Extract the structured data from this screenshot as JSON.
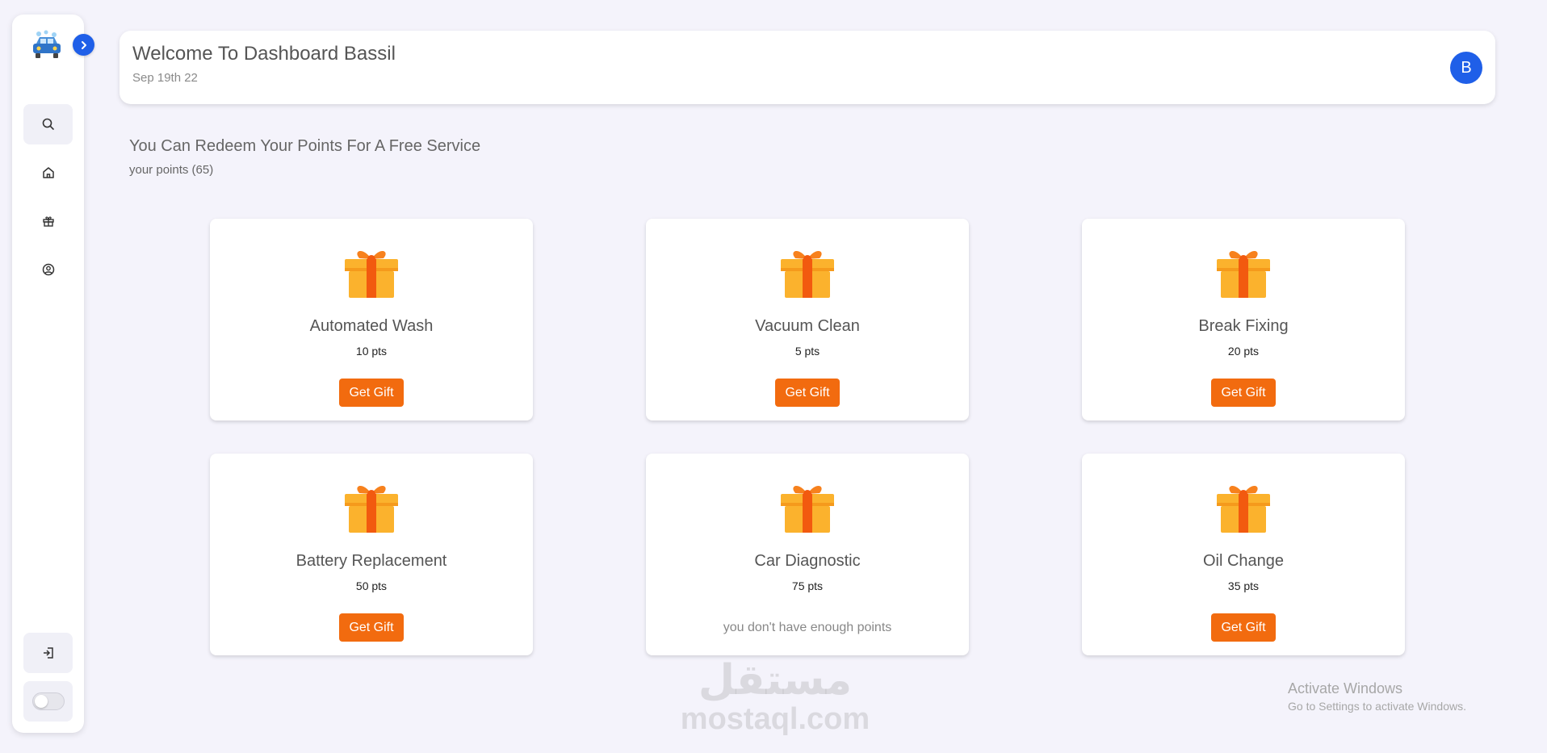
{
  "header": {
    "title": "Welcome To Dashboard Bassil",
    "date": "Sep 19th 22",
    "avatar_letter": "B"
  },
  "sidebar": {
    "items": [
      {
        "icon": "search-icon",
        "active": true
      },
      {
        "icon": "home-icon",
        "active": false
      },
      {
        "icon": "gift-icon",
        "active": false
      },
      {
        "icon": "user-circle-icon",
        "active": false
      }
    ],
    "logout_icon": "logout-icon",
    "expand_icon": "chevron-right-icon"
  },
  "rewards": {
    "title": "You Can Redeem Your Points For A Free Service",
    "points_label": "your points (65)",
    "cards": [
      {
        "name": "Automated Wash",
        "pts": "10 pts",
        "action": "Get Gift"
      },
      {
        "name": "Vacuum Clean",
        "pts": "5 pts",
        "action": "Get Gift"
      },
      {
        "name": "Break Fixing",
        "pts": "20 pts",
        "action": "Get Gift"
      },
      {
        "name": "Battery Replacement",
        "pts": "50 pts",
        "action": "Get Gift"
      },
      {
        "name": "Car Diagnostic",
        "pts": "75 pts",
        "message": "you don't have enough points"
      },
      {
        "name": "Oil Change",
        "pts": "35 pts",
        "action": "Get Gift"
      }
    ]
  },
  "watermark": {
    "arabic": "مستقل",
    "latin": "mostaql.com"
  },
  "activate_windows": {
    "line1": "Activate Windows",
    "line2": "Go to Settings to activate Windows."
  },
  "colors": {
    "accent_blue": "#1f5fe8",
    "button_orange": "#f26b0f",
    "background": "#f4f3fb"
  }
}
